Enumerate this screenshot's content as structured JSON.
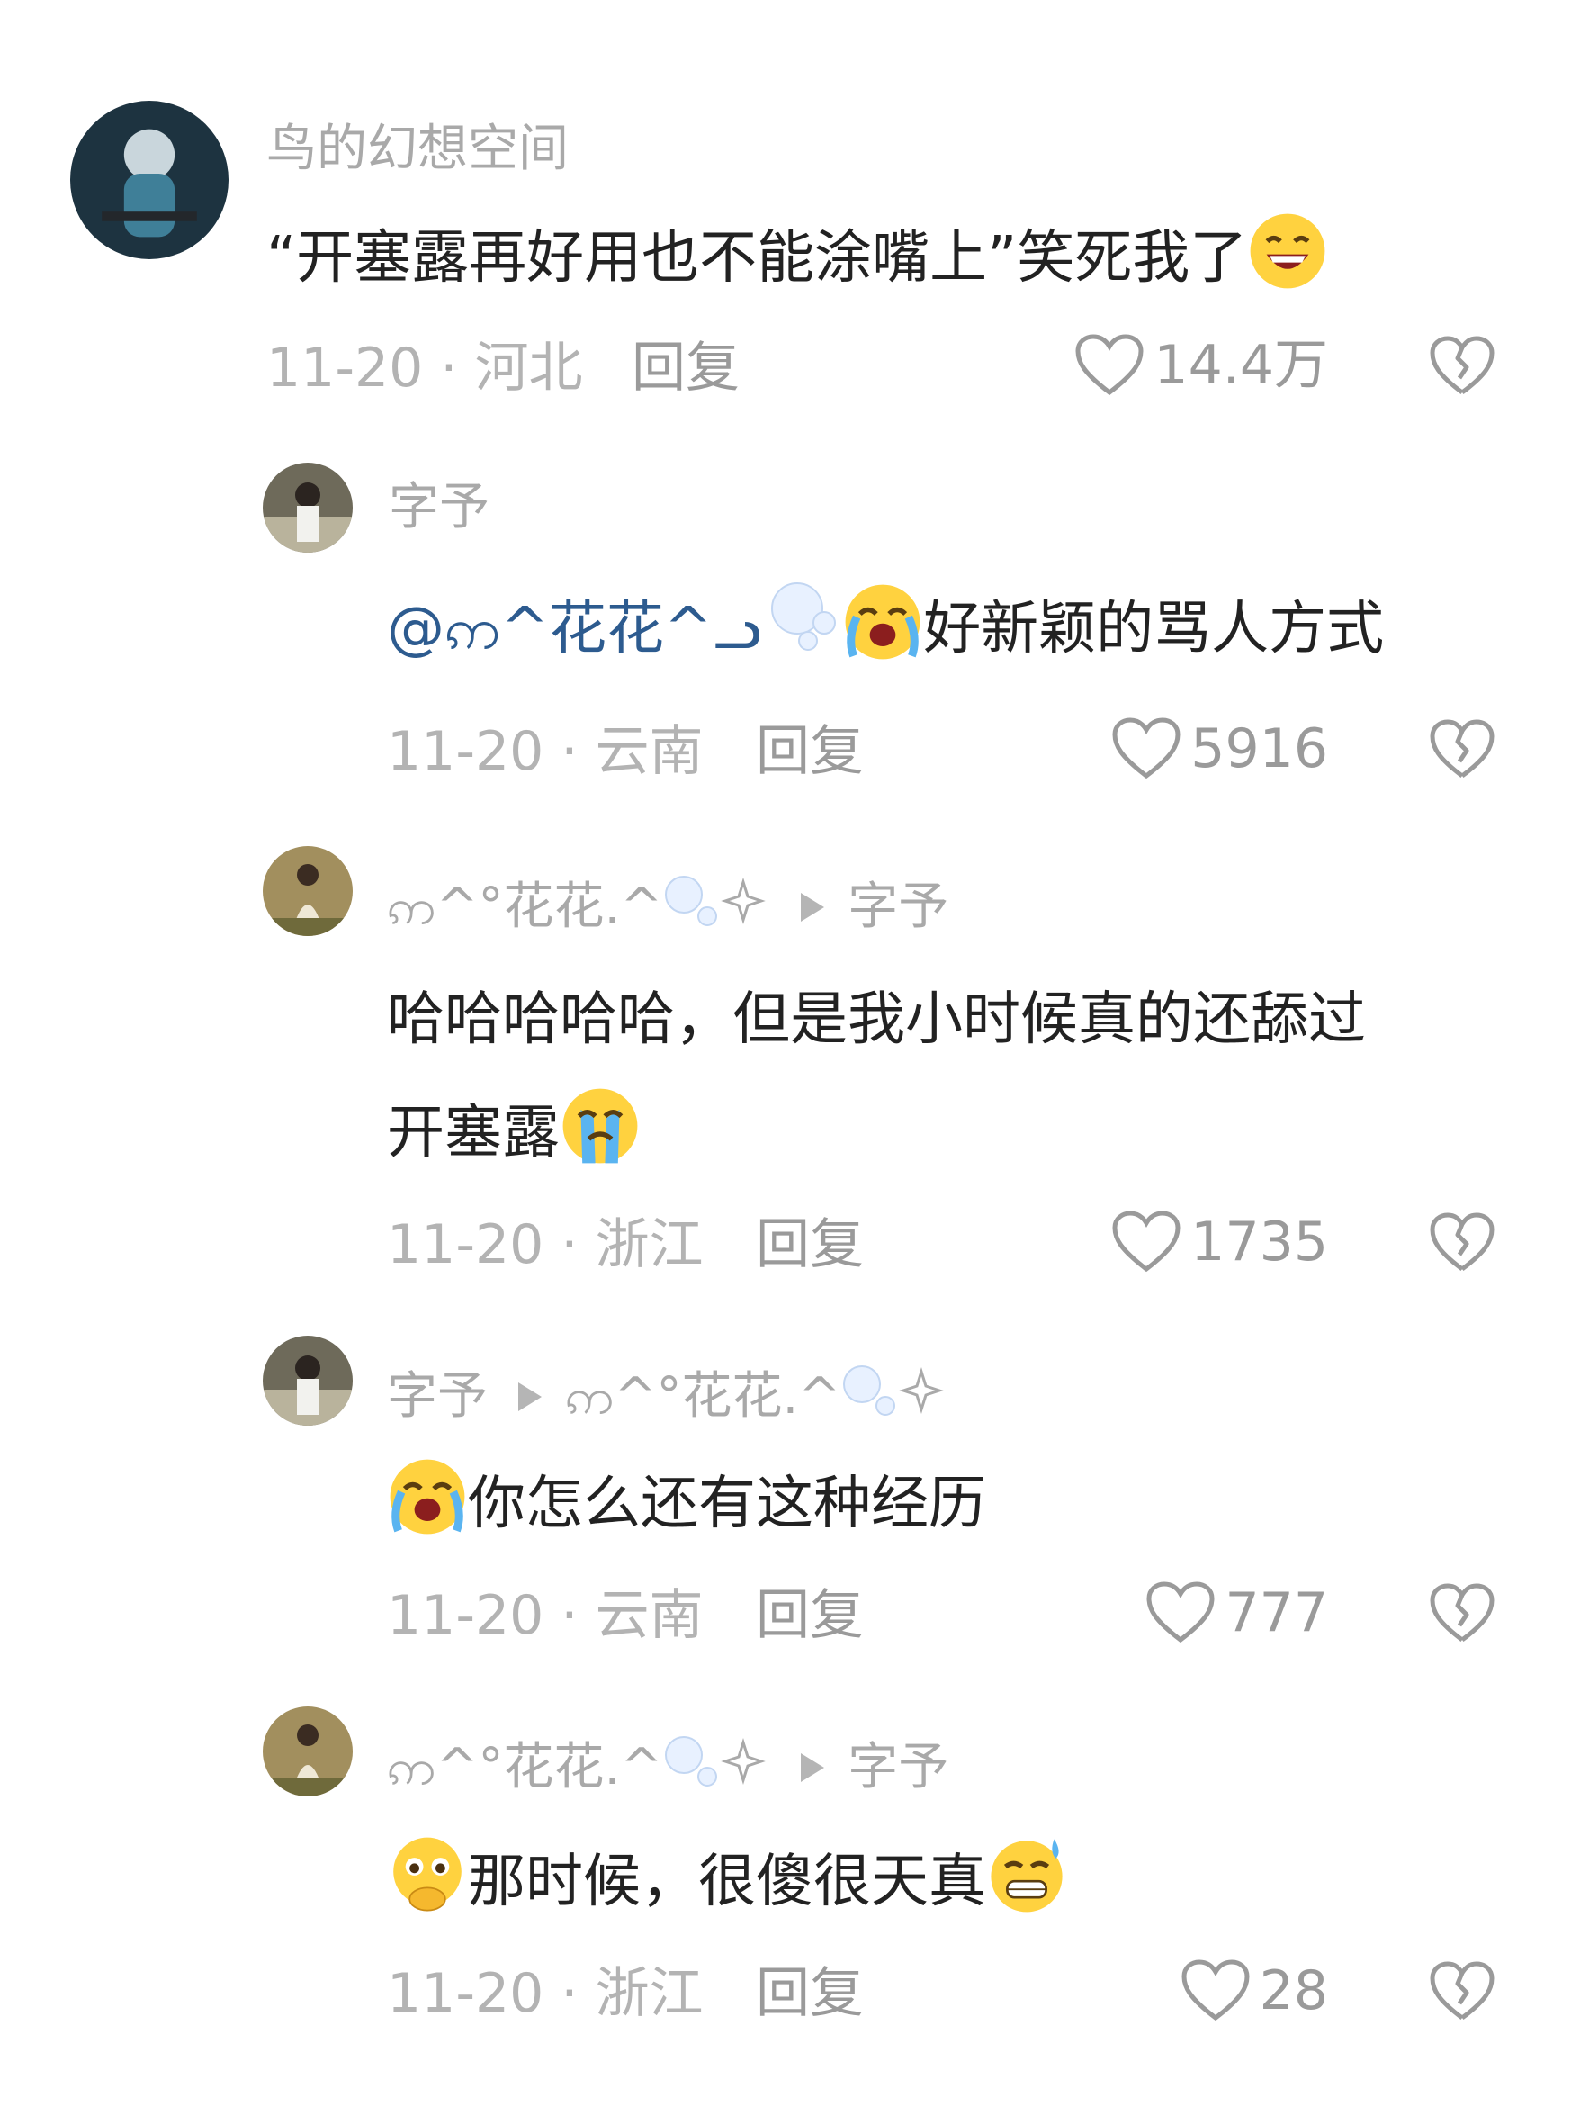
{
  "comments": [
    {
      "name": "鸟的幻想空间",
      "text": "“开塞露再好用也不能涂嘴上”笑死我了",
      "emoji_end": "grinning-sweat-face",
      "date_location": "11-20 · 河北",
      "reply_label": "回复",
      "likes": "14.4万"
    },
    {
      "name": "字予",
      "mention": "@ဢ^花花^ᓗ",
      "emoji_mid": "loudly-crying-face",
      "text": "好新颖的骂人方式",
      "date_location": "11-20 · 云南",
      "reply_label": "回复",
      "likes": "5916"
    },
    {
      "name": "ဢ^°花花.^",
      "reply_to": "字予",
      "text_line1": "哈哈哈哈哈，但是我小时候真的还舔过",
      "text_line2": "开塞露",
      "emoji_end": "crying-face",
      "date_location": "11-20 · 浙江",
      "reply_label": "回复",
      "likes": "1735"
    },
    {
      "name": "字予",
      "reply_to": "ဢ^°花花.^",
      "emoji_start": "loudly-crying-face",
      "text": "你怎么还有这种经历",
      "date_location": "11-20 · 云南",
      "reply_label": "回复",
      "likes": "777"
    },
    {
      "name": "ဢ^°花花.^",
      "reply_to": "字予",
      "emoji_start": "pleading-hands-face",
      "text": "那时候，很傻很天真",
      "emoji_end": "grimacing-sweat-face",
      "date_location": "11-20 · 浙江",
      "reply_label": "回复",
      "likes": "28"
    }
  ],
  "colors": {
    "name": "#a9a9a9",
    "text": "#222222",
    "mention": "#2d5b8f",
    "meta": "#b3b3b3",
    "icon": "#9a9a9a"
  }
}
